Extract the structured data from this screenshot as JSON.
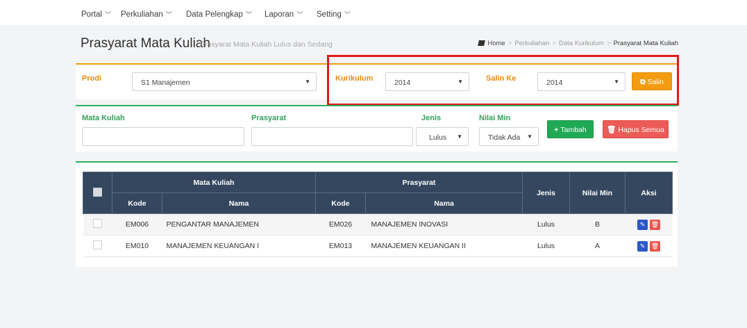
{
  "nav": {
    "items": [
      {
        "label": "Portal"
      },
      {
        "label": "Perkuliahan"
      },
      {
        "label": "Data Pelengkap"
      },
      {
        "label": "Laporan"
      },
      {
        "label": "Setting"
      }
    ]
  },
  "header": {
    "title": "Prasyarat Mata Kuliah",
    "subtitle": "Prasyarat Mata Kuliah Lulus dan Sedang",
    "breadcrumb": [
      "Home",
      "Perkuliahan",
      "Data Kurikulum",
      "Prasyarat Mata Kuliah"
    ],
    "breadcrumb_sep": ">"
  },
  "filter": {
    "prodi_label": "Prodi",
    "prodi_value": "S1 Manajemen",
    "kurikulum_label": "Kurikulum",
    "kurikulum_value": "2014",
    "salin_ke_label": "Salin Ke",
    "salin_ke_value": "2014",
    "salin_button": "Salin"
  },
  "form": {
    "mata_kuliah_label": "Mata Kuliah",
    "mata_kuliah_value": "",
    "prasyarat_label": "Prasyarat",
    "prasyarat_value": "",
    "jenis_label": "Jenis",
    "jenis_value": "Lulus",
    "nilai_min_label": "Nilai Min",
    "nilai_min_value": "Tidak Ada",
    "tambah_button": "Tambah",
    "hapus_button": "Hapus Semua"
  },
  "table": {
    "group_mk": "Mata Kuliah",
    "group_prasyarat": "Prasyarat",
    "col_jenis": "Jenis",
    "col_nilai_min": "Nilai Min",
    "col_aksi": "Aksi",
    "col_kode": "Kode",
    "col_nama": "Nama",
    "rows": [
      {
        "mk_kode": "EM006",
        "mk_nama": "PENGANTAR MANAJEMEN",
        "pr_kode": "EM026",
        "pr_nama": "MANAJEMEN INOVASI",
        "jenis": "Lulus",
        "nilai_min": "B"
      },
      {
        "mk_kode": "EM010",
        "mk_nama": "MANAJEMEN KEUANGAN I",
        "pr_kode": "EM013",
        "pr_nama": "MANAJEMEN KEUANGAN II",
        "jenis": "Lulus",
        "nilai_min": "A"
      }
    ]
  },
  "colors": {
    "orange": "#f39c12",
    "green": "#2fae61",
    "header_bg": "#34475f",
    "danger": "#ec5b57",
    "edit": "#2b57c7",
    "highlight": "#e11919"
  },
  "icons": {
    "nav_chevron": "chevron-down-icon",
    "breadcrumb_home": "book-icon",
    "salin": "copy-icon",
    "tambah": "plus-icon",
    "hapus": "trash-icon",
    "edit": "pencil-icon",
    "delete": "trash-icon"
  }
}
